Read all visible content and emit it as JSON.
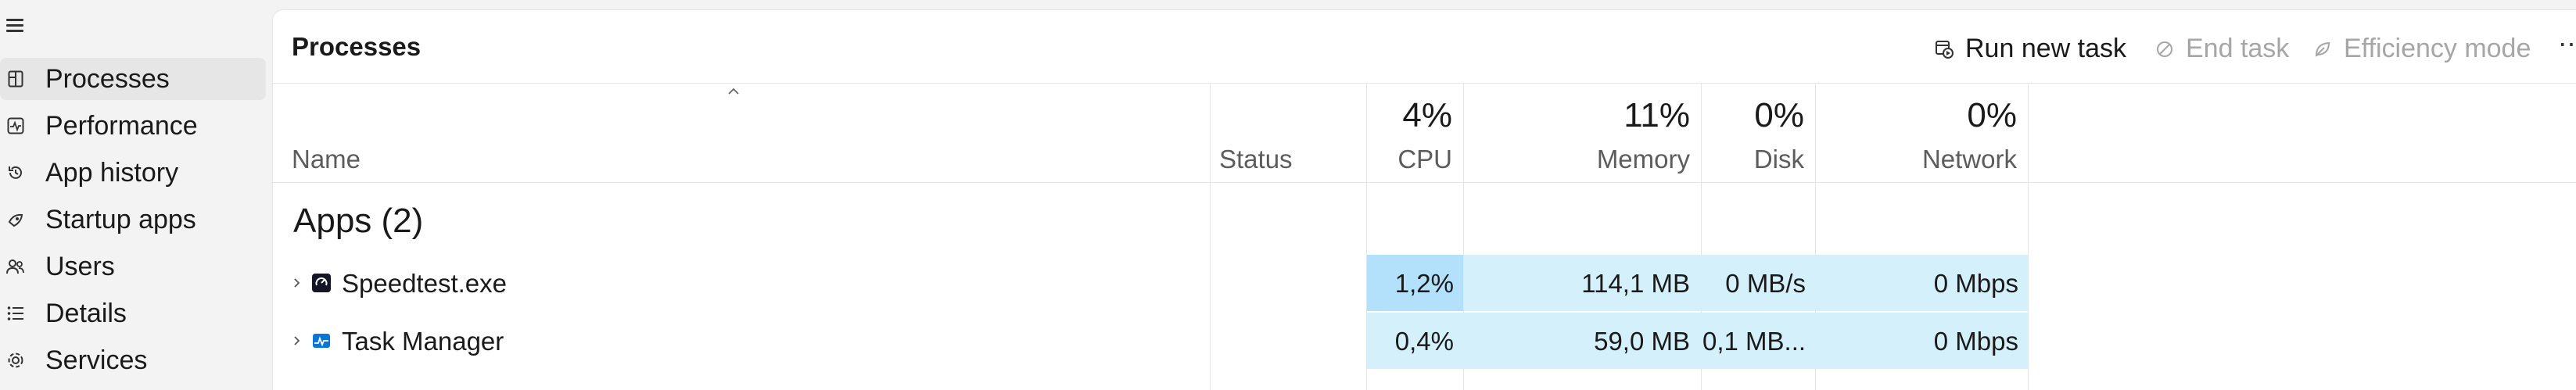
{
  "sidebar": {
    "items": [
      {
        "label": "Processes",
        "icon": "processes-icon",
        "active": true
      },
      {
        "label": "Performance",
        "icon": "performance-icon"
      },
      {
        "label": "App history",
        "icon": "app-history-icon"
      },
      {
        "label": "Startup apps",
        "icon": "startup-apps-icon"
      },
      {
        "label": "Users",
        "icon": "users-icon"
      },
      {
        "label": "Details",
        "icon": "details-icon"
      },
      {
        "label": "Services",
        "icon": "services-icon"
      }
    ]
  },
  "header": {
    "title": "Processes",
    "run_new_task": "Run new task",
    "end_task": "End task",
    "efficiency_mode": "Efficiency mode",
    "more": "⋯"
  },
  "columns": {
    "name": "Name",
    "status": "Status",
    "cpu": {
      "pct": "4%",
      "label": "CPU"
    },
    "memory": {
      "pct": "11%",
      "label": "Memory"
    },
    "disk": {
      "pct": "0%",
      "label": "Disk"
    },
    "network": {
      "pct": "0%",
      "label": "Network"
    }
  },
  "group": {
    "label": "Apps (2)"
  },
  "rows": [
    {
      "name": "Speedtest.exe",
      "cpu": "1,2%",
      "memory": "114,1 MB",
      "disk": "0 MB/s",
      "network": "0 Mbps"
    },
    {
      "name": "Task Manager",
      "cpu": "0,4%",
      "memory": "59,0 MB",
      "disk": "0,1 MB...",
      "network": "0 Mbps"
    }
  ],
  "colors": {
    "cpu_high": "#b3e0fa",
    "usage_low": "#d4f0fb",
    "accent": "#0067c0"
  }
}
